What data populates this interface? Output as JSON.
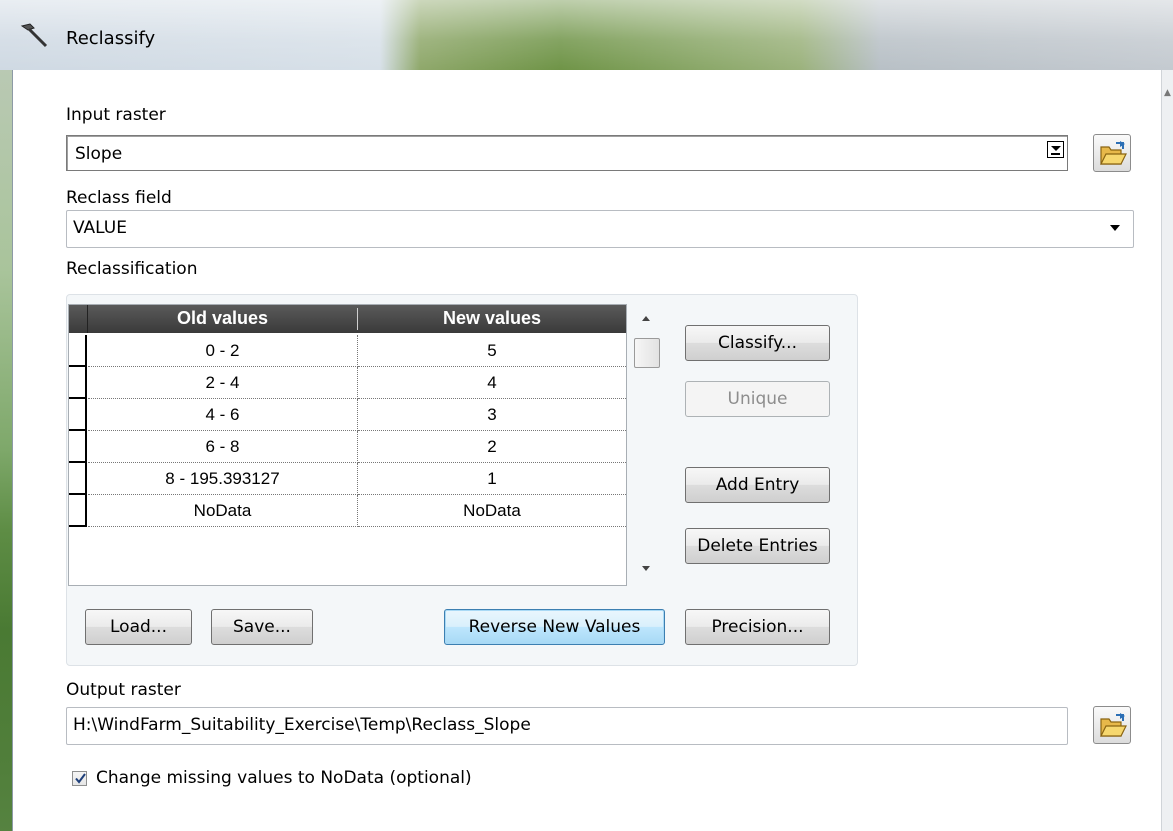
{
  "window": {
    "title": "Reclassify"
  },
  "input_raster": {
    "label": "Input raster",
    "value": "Slope"
  },
  "reclass_field": {
    "label": "Reclass field",
    "value": "VALUE"
  },
  "reclassification": {
    "label": "Reclassification",
    "columns": [
      "Old values",
      "New values"
    ],
    "rows": [
      {
        "old": "0 - 2",
        "new": "5"
      },
      {
        "old": "2 - 4",
        "new": "4"
      },
      {
        "old": "4 - 6",
        "new": "3"
      },
      {
        "old": "6 - 8",
        "new": "2"
      },
      {
        "old": "8 - 195.393127",
        "new": "1"
      },
      {
        "old": "NoData",
        "new": "NoData"
      }
    ],
    "buttons": {
      "classify": "Classify...",
      "unique": "Unique",
      "add_entry": "Add Entry",
      "delete_entries": "Delete Entries",
      "load": "Load...",
      "save": "Save...",
      "reverse": "Reverse New Values",
      "precision": "Precision..."
    }
  },
  "output_raster": {
    "label": "Output raster",
    "value": "H:\\WindFarm_Suitability_Exercise\\Temp\\Reclass_Slope"
  },
  "missing_values": {
    "label": "Change missing values to NoData (optional)",
    "checked": true
  }
}
